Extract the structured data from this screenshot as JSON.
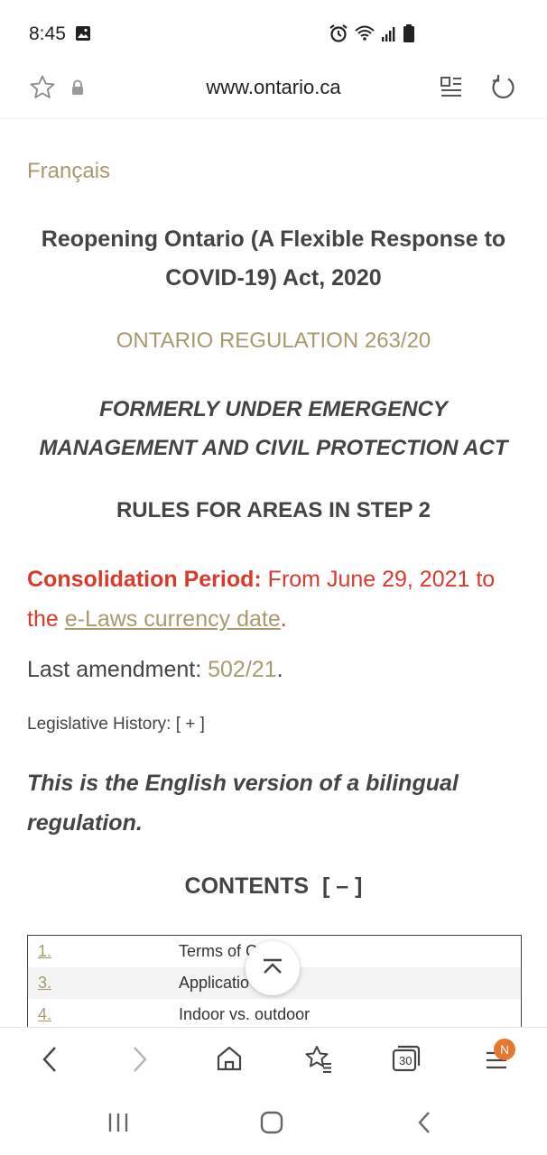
{
  "status_bar": {
    "time": "8:45",
    "icons": [
      "gallery-icon",
      "alarm-icon",
      "wifi-icon",
      "signal-icon",
      "battery-icon"
    ]
  },
  "url_bar": {
    "url": "www.ontario.ca",
    "icons": [
      "star-icon",
      "lock-icon",
      "reader-mode-icon",
      "reload-icon"
    ]
  },
  "page": {
    "language_link": "Français",
    "act_title": "Reopening Ontario (A Flexible Response to COVID-19) Act, 2020",
    "regulation_number": "ONTARIO REGULATION 263/20",
    "formerly": "FORMERLY UNDER EMERGENCY MANAGEMENT AND CIVIL PROTECTION ACT",
    "rules_heading": "RULES FOR AREAS IN STEP 2",
    "consolidation_label": "Consolidation Period:",
    "consolidation_text": "From June 29, 2021 to the",
    "consolidation_link": "e-Laws currency date",
    "period_end": ".",
    "last_amendment_label": "Last amendment:",
    "last_amendment_value": "502/21",
    "legislative_history": "Legislative History: [ + ]",
    "bilingual_note": "This is the English version of a bilingual regulation.",
    "contents_heading": "CONTENTS",
    "contents_toggle": "[ – ]",
    "toc": [
      {
        "number": "1.",
        "title": "Terms of C"
      },
      {
        "number": "3.",
        "title": "Applicatio"
      },
      {
        "number": "4.",
        "title": "Indoor vs. outdoor"
      }
    ]
  },
  "toolbar": {
    "tabs_count": "30",
    "notification_badge": "N",
    "icons": [
      "back-icon",
      "forward-icon",
      "home-icon",
      "bookmarks-icon",
      "tabs-icon",
      "menu-icon"
    ]
  },
  "system_nav": {
    "icons": [
      "recents-icon",
      "home-button-icon",
      "back-button-icon"
    ]
  },
  "colors": {
    "link": "#a89a6c",
    "consolidation": "#d93a2b",
    "badge": "#e8772e",
    "text": "#444444"
  }
}
